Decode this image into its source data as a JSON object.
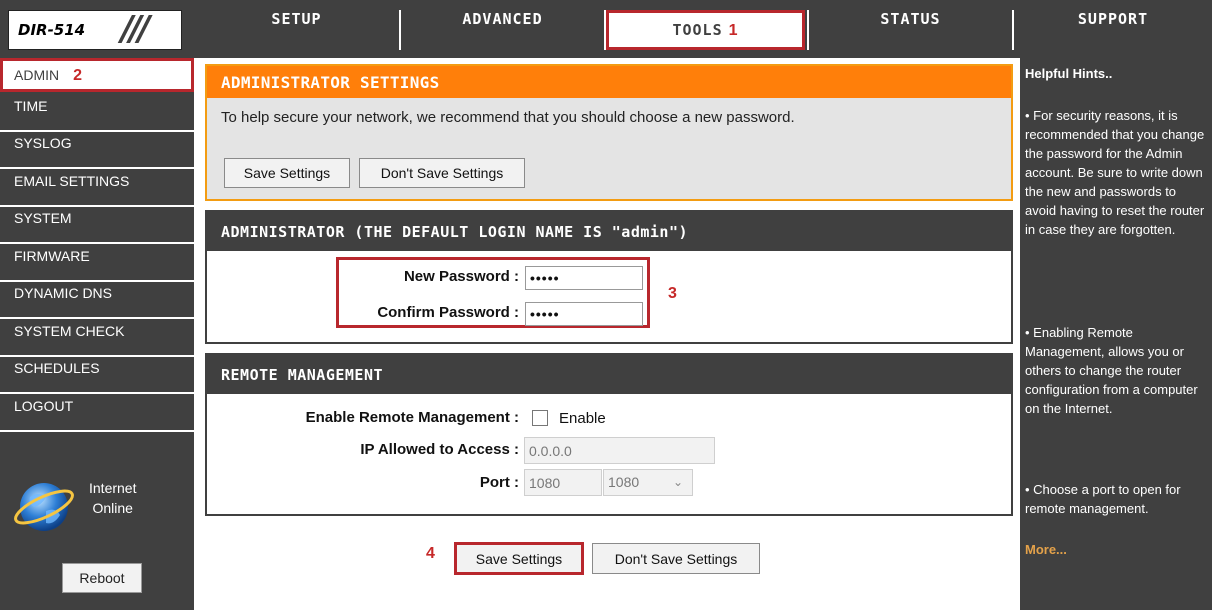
{
  "header": {
    "model": "DIR-514",
    "slashes": "///",
    "tabs": [
      {
        "label": "SETUP"
      },
      {
        "label": "ADVANCED"
      },
      {
        "label": "TOOLS",
        "badge": "1"
      },
      {
        "label": "STATUS"
      },
      {
        "label": "SUPPORT"
      }
    ]
  },
  "sidebar": {
    "items": [
      {
        "label": "ADMIN",
        "badge": "2"
      },
      {
        "label": "TIME"
      },
      {
        "label": "SYSLOG"
      },
      {
        "label": "EMAIL SETTINGS"
      },
      {
        "label": "SYSTEM"
      },
      {
        "label": "FIRMWARE"
      },
      {
        "label": "DYNAMIC DNS"
      },
      {
        "label": "SYSTEM CHECK"
      },
      {
        "label": "SCHEDULES"
      },
      {
        "label": "LOGOUT"
      }
    ],
    "status_line1": "Internet",
    "status_line2": "Online",
    "reboot": "Reboot"
  },
  "admin_settings": {
    "title": "ADMINISTRATOR SETTINGS",
    "description": "To help secure your network, we recommend that you should choose a new password.",
    "save": "Save Settings",
    "dont_save": "Don't Save Settings"
  },
  "administrator": {
    "title": "ADMINISTRATOR (THE DEFAULT LOGIN NAME IS \"admin\")",
    "new_password_label": "New Password :",
    "new_password_value": "•••••",
    "confirm_password_label": "Confirm Password :",
    "confirm_password_value": "•••••",
    "badge": "3"
  },
  "remote": {
    "title": "REMOTE MANAGEMENT",
    "enable_label": "Enable Remote Management :",
    "enable_checkbox_label": "Enable",
    "ip_label": "IP Allowed to Access :",
    "ip_value": "0.0.0.0",
    "port_label": "Port :",
    "port_value": "1080",
    "port_select": "1080"
  },
  "footer": {
    "badge": "4",
    "save": "Save Settings",
    "dont_save": "Don't Save Settings"
  },
  "hints": {
    "title": "Helpful Hints..",
    "items": [
      "• For security reasons, it is recommended that you change the password for the Admin account. Be sure to write down the new and passwords to avoid having to reset the router in case they are forgotten.",
      "• Enabling Remote Management, allows you or others to change the router configuration from a computer on the Internet.",
      "• Choose a port to open for remote management."
    ],
    "more": "More..."
  },
  "colors": {
    "dark": "#404040",
    "orange": "#ff7f0a",
    "highlight": "#b8272d",
    "link": "#e4a24a"
  }
}
